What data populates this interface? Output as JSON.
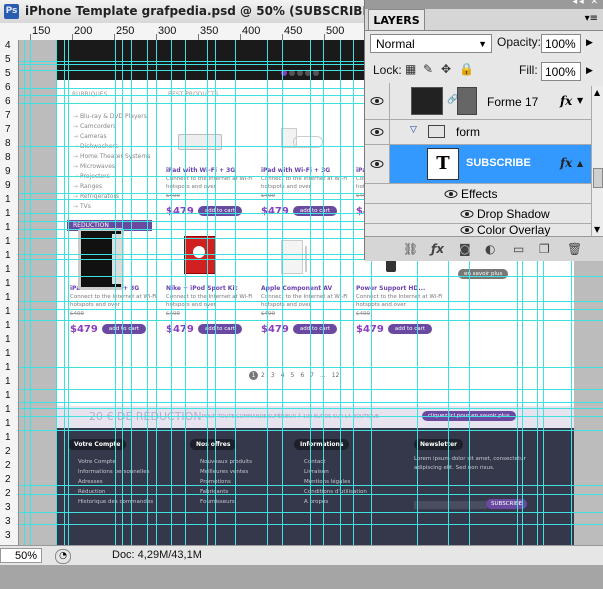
{
  "window": {
    "title": "iPhone Template grafpedia.psd @ 50% (SUBSCRIBE, RGB/8)",
    "logo": "Ps"
  },
  "ruler": {
    "top_ticks": [
      "150",
      "200",
      "250",
      "300",
      "350",
      "400",
      "450",
      "500",
      "550",
      "600",
      "650",
      "700"
    ],
    "left_ticks": [
      "4",
      "5",
      "5",
      "6",
      "6",
      "7",
      "7",
      "8",
      "8",
      "9",
      "9",
      "1",
      "1",
      "1",
      "1",
      "1",
      "1",
      "1",
      "1",
      "1",
      "1",
      "1",
      "1",
      "1",
      "1",
      "1",
      "1",
      "1",
      "1",
      "2",
      "2",
      "2",
      "2",
      "3",
      "3",
      "3"
    ]
  },
  "design": {
    "col_heads": {
      "rubriques": "RUBRIQUES",
      "best": "BEST PRODUCTS"
    },
    "rubriques": [
      "Blu-ray & DVD Players",
      "Camcorders",
      "Cameras",
      "Dishwashers",
      "Home Theater Systems",
      "Microwaves",
      "Projectors",
      "Ranges",
      "Refrigerators",
      "TVs"
    ],
    "reduction_label": "REDUCTION",
    "products": [
      {
        "name": "iPad with Wi-Fi + 3G",
        "desc": "Connect to the Internet at Wi-Fi hotspots and over",
        "old": "$499",
        "price": "$479",
        "btn": "add to cart",
        "icon": "keyboard-image"
      },
      {
        "name": "iPad with Wi-Fi + 3G",
        "desc": "Connect to the Internet at Wi-Fi hotspots and over",
        "old": "$499",
        "price": "$479",
        "btn": "add to cart",
        "icon": "cable-image"
      },
      {
        "name": "iPad with Wi-Fi + 3G",
        "desc": "Connect to the Internet at Wi-Fi hotspots and over",
        "old": "$499",
        "price": "$479",
        "btn": "add to cart",
        "icon": "product-image"
      },
      {
        "name": "iPad with Wi-Fi + 3G",
        "desc": "Connect to the Internet at Wi-Fi hotspots and over",
        "old": "$499",
        "price": "$479",
        "btn": "add to cart",
        "icon": "ipad-image"
      },
      {
        "name": "Nike + iPod Sport Kit",
        "desc": "Connect to the Internet at Wi-Fi hotspots and over",
        "old": "$499",
        "price": "$479",
        "btn": "add to cart",
        "icon": "red-box-image"
      },
      {
        "name": "Apple Component AV",
        "desc": "Connect to the Internet at Wi-Fi hotspots and over",
        "old": "$499",
        "price": "$479",
        "btn": "add to cart",
        "icon": "av-cable-image"
      },
      {
        "name": "Power Support HD...",
        "desc": "Connect to the Internet at Wi-Fi hotspots and over",
        "old": "$499",
        "price": "$479",
        "btn": "add to cart",
        "icon": "phone-image"
      }
    ],
    "en_savoir": "en savoir plus",
    "pagination": {
      "current": "1",
      "pages": [
        "2",
        "3",
        "4",
        "5",
        "6",
        "7",
        "...",
        "12"
      ]
    },
    "promo": {
      "big": "20 € DE RÉDUCTION",
      "small": "POUR TOUTE COMMANDE SUPÉRIEUR À 100 EUROS SUR LA BOUTIQUE",
      "btn": "cliquez ici pour en savoir plus"
    },
    "footer": {
      "cols": [
        {
          "head": "Votre Compte",
          "items": [
            "Votre Compte",
            "Informations personnelles",
            "Adresses",
            "Réduction",
            "Historique des commandes"
          ]
        },
        {
          "head": "Nos offres",
          "items": [
            "Nouveaux produits",
            "Meilleures ventes",
            "Promotions",
            "Fabricants",
            "Fournisseurs"
          ]
        },
        {
          "head": "Informations",
          "items": [
            "Contact",
            "Livraison",
            "Mentions légales",
            "Conditions d'utilisation",
            "A propos"
          ]
        }
      ],
      "newsletter": {
        "head": "Newsletter",
        "text": "Lorem ipsum dolor sit amet, consectetur adipiscing elit. Sed non risus.",
        "btn": "SUBSCRIBE"
      }
    }
  },
  "status": {
    "zoom": "50%",
    "doc": "Doc: 4,29M/43,1M"
  },
  "layers": {
    "tab": "LAYERS",
    "blend_mode": "Normal",
    "opacity_label": "Opacity:",
    "opacity": "100%",
    "lock_label": "Lock:",
    "fill_label": "Fill:",
    "fill": "100%",
    "rows": {
      "forme17": "Forme 17",
      "form": "form",
      "subscribe": "SUBSCRIBE",
      "effects": "Effects",
      "drop_shadow": "Drop Shadow",
      "color_overlay": "Color Overlay"
    },
    "fx": "fx",
    "type_glyph": "T"
  },
  "colors": {
    "guide": "#3ee0e0",
    "accent": "#6a4aa0",
    "selection": "#3399ff"
  }
}
